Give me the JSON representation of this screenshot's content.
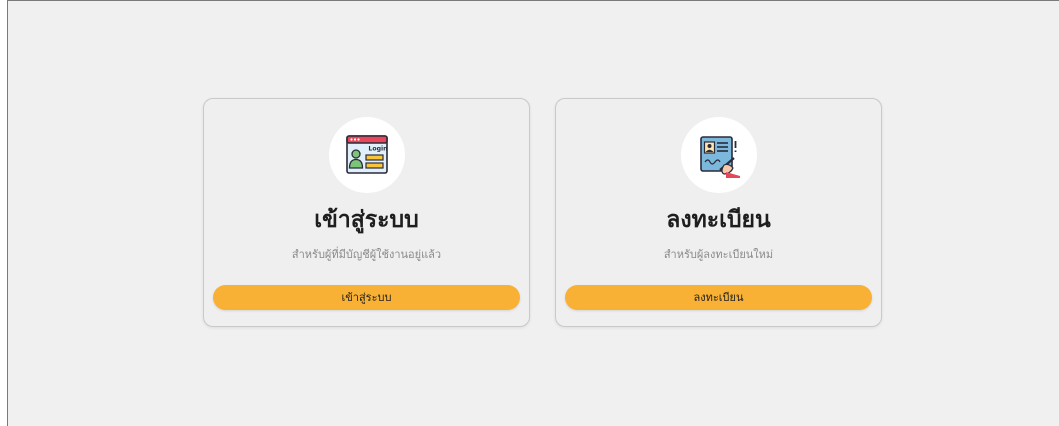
{
  "login_card": {
    "icon": "login-window-icon",
    "icon_text": "Login",
    "title": "เข้าสู่ระบบ",
    "subtitle": "สำหรับผู้ที่มีบัญชีผู้ใช้งานอยู่แล้ว",
    "button_label": "เข้าสู่ระบบ"
  },
  "register_card": {
    "icon": "signing-document-icon",
    "title": "ลงทะเบียน",
    "subtitle": "สำหรับผู้ลงทะเบียนใหม่",
    "button_label": "ลงทะเบียน"
  },
  "colors": {
    "accent": "#f8b134",
    "page_background": "#f0f0f0",
    "card_background": "#efefef"
  }
}
